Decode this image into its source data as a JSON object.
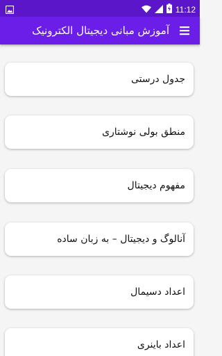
{
  "status": {
    "time": "11:12"
  },
  "app_bar": {
    "title": "آموزش مبانی دیجیتال الکترونیک"
  },
  "lessons": [
    {
      "label": "جدول درستی"
    },
    {
      "label": "منطق بولی نوشتاری"
    },
    {
      "label": "مفهوم دیجیتال"
    },
    {
      "label": "آنالوگ و دیجیتال – به زبان ساده"
    },
    {
      "label": "اعداد دسیمال"
    },
    {
      "label": "اعداد  باینری"
    }
  ],
  "colors": {
    "status_bar": "#5b16c9",
    "app_bar": "#6a1ee8",
    "background": "#f5f5f5"
  },
  "icons": {
    "status_left": "image-icon",
    "wifi": "wifi-icon",
    "cellular": "cellular-signal-icon",
    "battery": "battery-charging-icon",
    "menu": "hamburger-menu-icon"
  }
}
